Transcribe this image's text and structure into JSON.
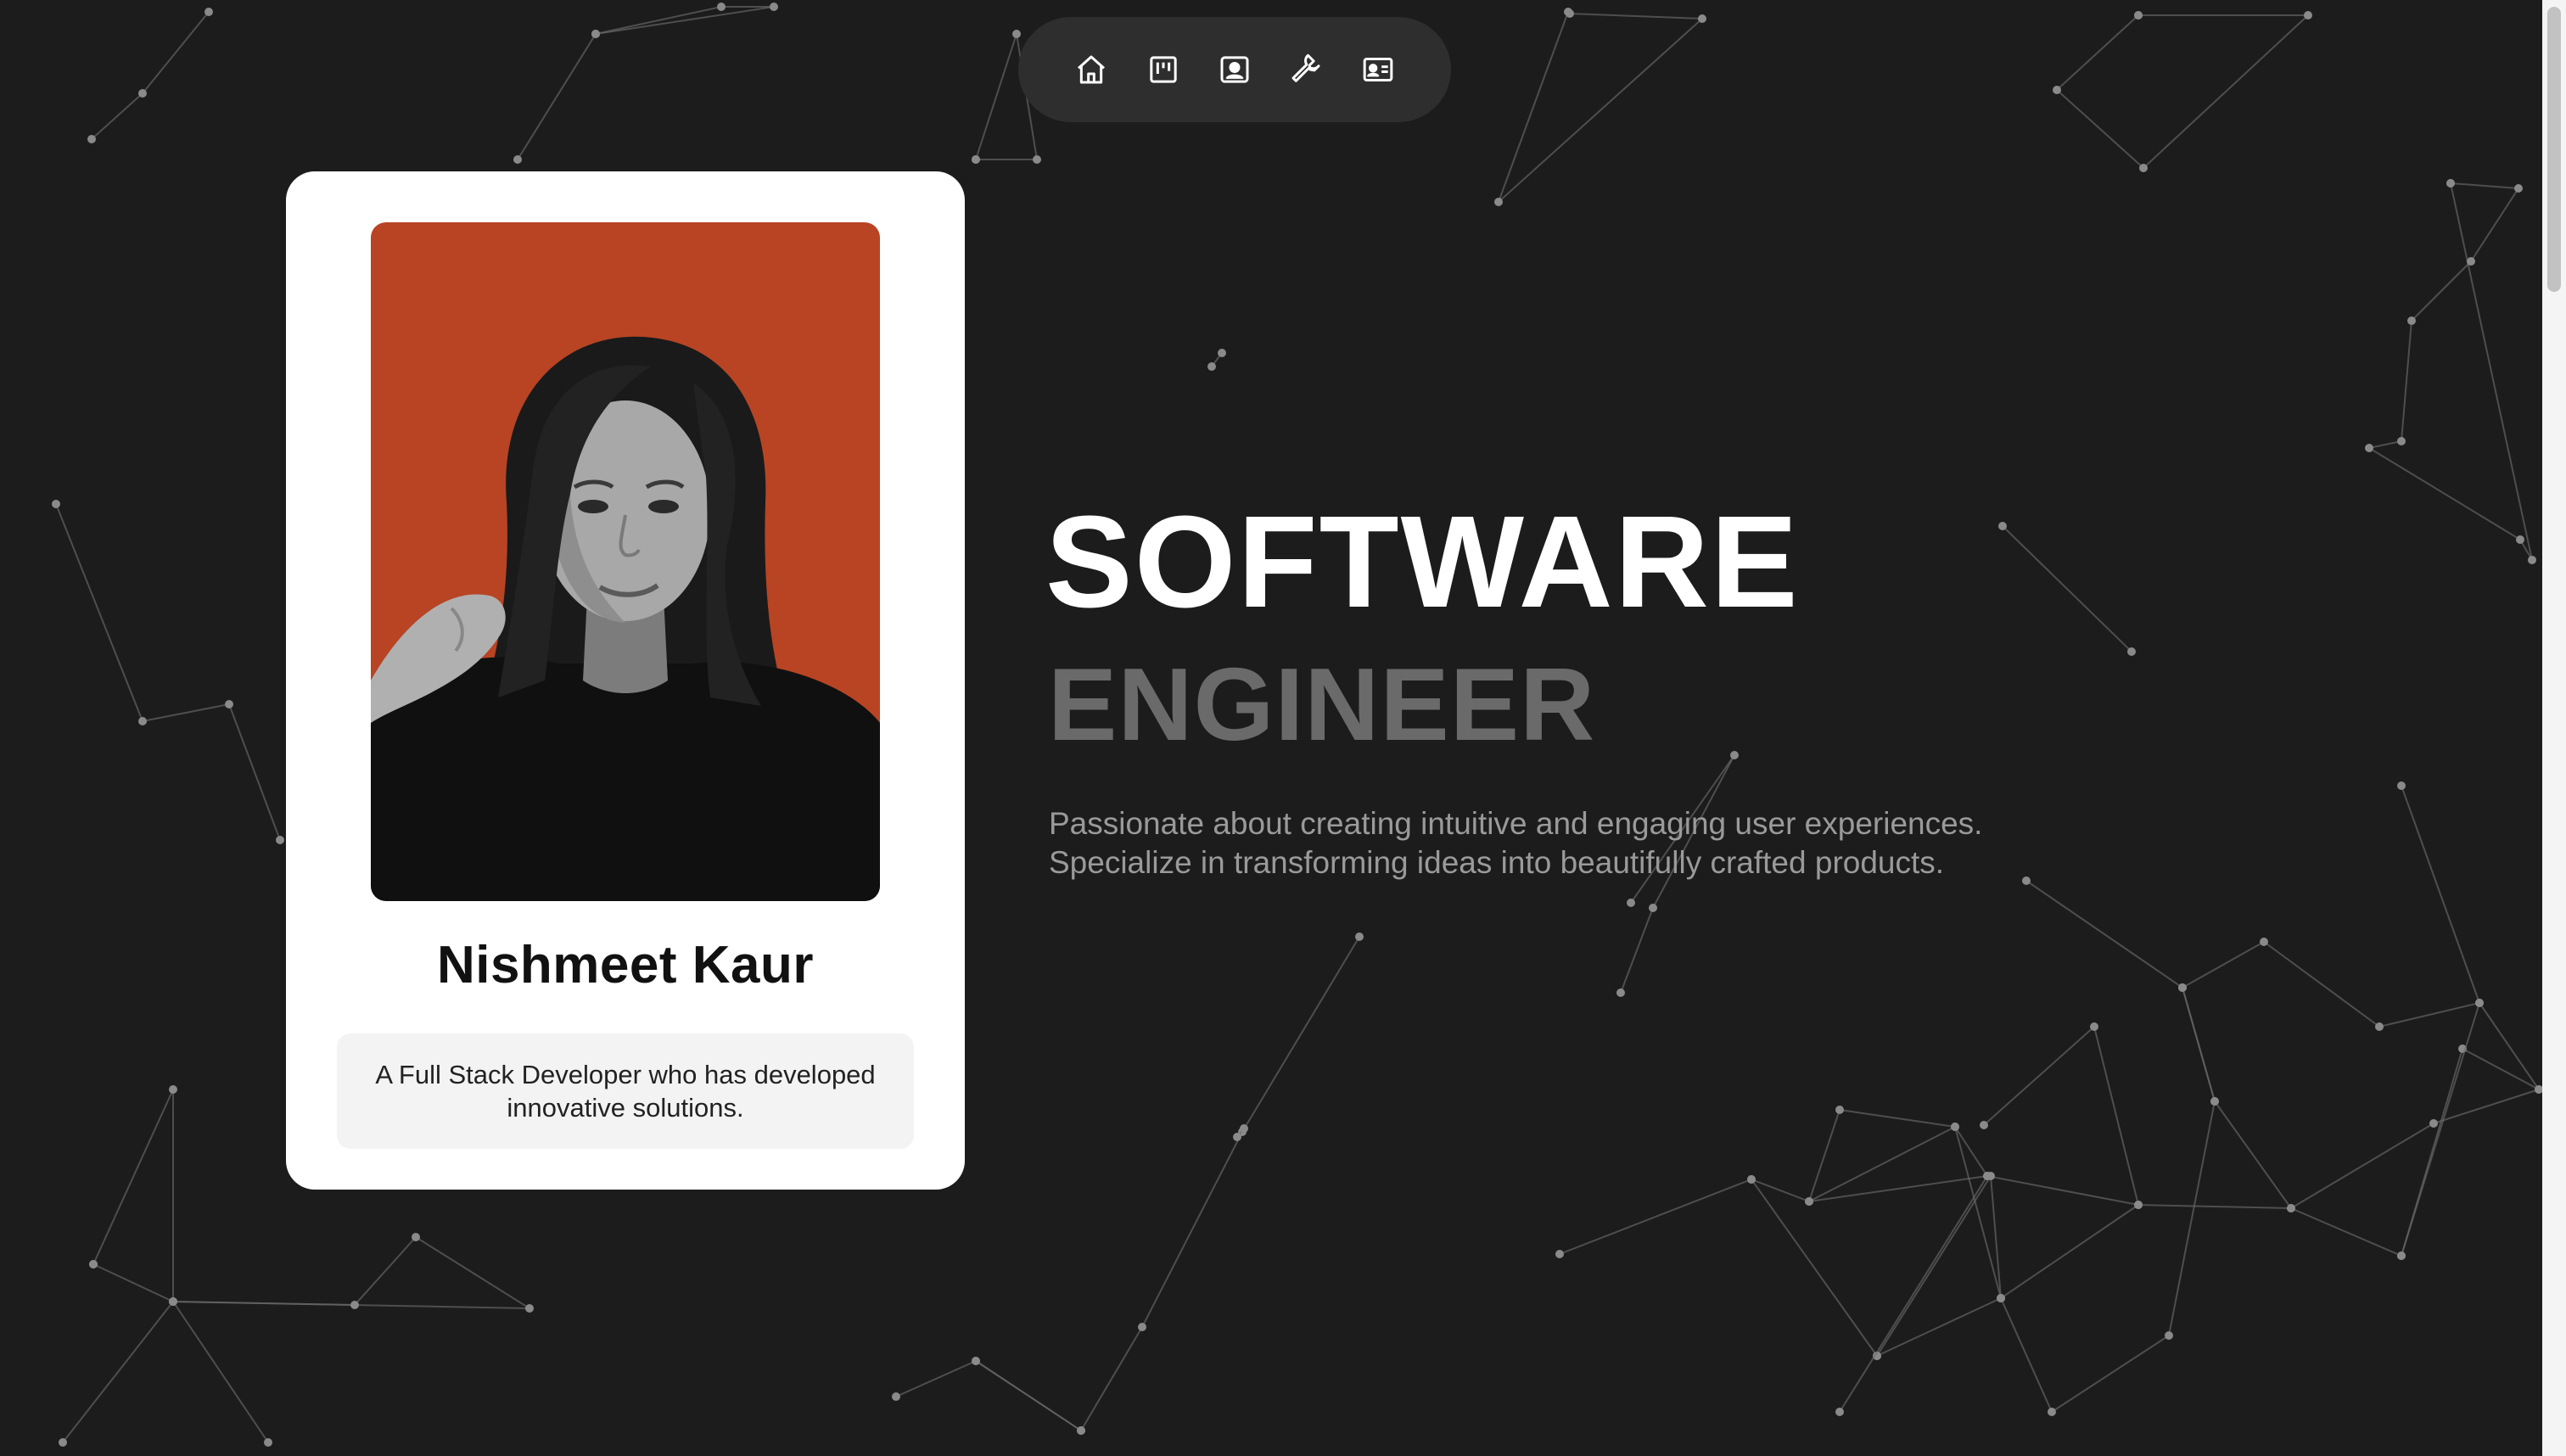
{
  "nav": {
    "items": [
      {
        "icon": "home-icon"
      },
      {
        "icon": "kanban-board-icon"
      },
      {
        "icon": "profile-portrait-icon"
      },
      {
        "icon": "wrench-icon"
      },
      {
        "icon": "contact-card-icon"
      }
    ]
  },
  "profile": {
    "name": "Nishmeet Kaur",
    "bio": "A Full Stack Developer who has developed innovative solutions.",
    "photo_bg_color": "#b84424"
  },
  "hero": {
    "title_line1": "SOFTWARE",
    "title_line2": "ENGINEER",
    "tagline_line1": "Passionate about creating intuitive and engaging user experiences.",
    "tagline_line2": "Specialize in transforming ideas into beautifully crafted products."
  },
  "colors": {
    "background": "#1c1c1c",
    "nav_bg": "#2e2e2e",
    "card_bg": "#ffffff",
    "title_primary": "#ffffff",
    "title_secondary": "#6a6a6a",
    "tagline": "#9a9a9a"
  }
}
